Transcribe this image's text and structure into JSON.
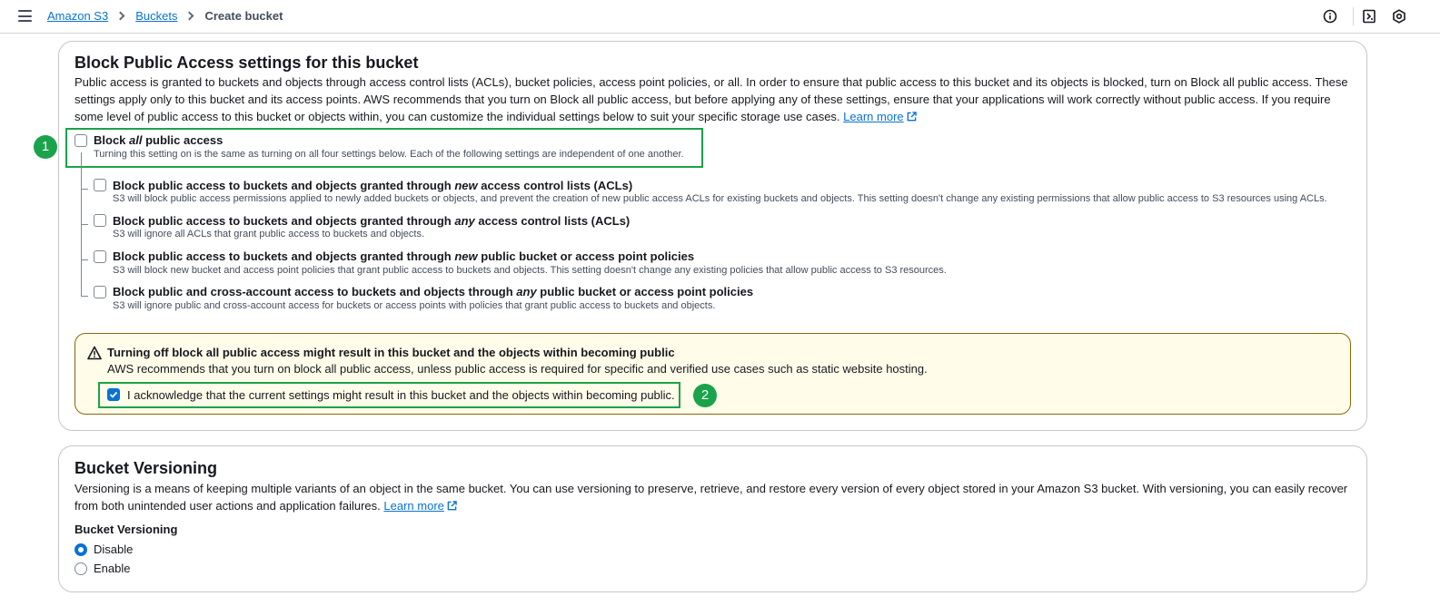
{
  "breadcrumb": {
    "items": [
      "Amazon S3",
      "Buckets"
    ],
    "current": "Create bucket"
  },
  "icons": [
    "menu-icon",
    "info-icon",
    "feedback-icon",
    "settings-icon"
  ],
  "block_public_access": {
    "title": "Block Public Access settings for this bucket",
    "description": "Public access is granted to buckets and objects through access control lists (ACLs), bucket policies, access point policies, or all. In order to ensure that public access to this bucket and its objects is blocked, turn on Block all public access. These settings apply only to this bucket and its access points. AWS recommends that you turn on Block all public access, but before applying any of these settings, ensure that your applications will work correctly without public access. If you require some level of public access to this bucket or objects within, you can customize the individual settings below to suit your specific storage use cases.",
    "learn_more": "Learn more",
    "block_all": {
      "pre": "Block ",
      "em": "all",
      "post": " public access",
      "description": "Turning this setting on is the same as turning on all four settings below. Each of the following settings are independent of one another.",
      "checked": false
    },
    "options": [
      {
        "pre": "Block public access to buckets and objects granted through ",
        "em": "new",
        "post": " access control lists (ACLs)",
        "description": "S3 will block public access permissions applied to newly added buckets or objects, and prevent the creation of new public access ACLs for existing buckets and objects. This setting doesn't change any existing permissions that allow public access to S3 resources using ACLs.",
        "checked": false
      },
      {
        "pre": "Block public access to buckets and objects granted through ",
        "em": "any",
        "post": " access control lists (ACLs)",
        "description": "S3 will ignore all ACLs that grant public access to buckets and objects.",
        "checked": false
      },
      {
        "pre": "Block public access to buckets and objects granted through ",
        "em": "new",
        "post": " public bucket or access point policies",
        "description": "S3 will block new bucket and access point policies that grant public access to buckets and objects. This setting doesn't change any existing policies that allow public access to S3 resources.",
        "checked": false
      },
      {
        "pre": "Block public and cross-account access to buckets and objects through ",
        "em": "any",
        "post": " public bucket or access point policies",
        "description": "S3 will ignore public and cross-account access for buckets or access points with policies that grant public access to buckets and objects.",
        "checked": false
      }
    ],
    "warning": {
      "title": "Turning off block all public access might result in this bucket and the objects within becoming public",
      "description": "AWS recommends that you turn on block all public access, unless public access is required for specific and verified use cases such as static website hosting.",
      "acknowledge": "I acknowledge that the current settings might result in this bucket and the objects within becoming public.",
      "acknowledged": true
    },
    "markers": [
      "1",
      "2"
    ]
  },
  "versioning": {
    "title": "Bucket Versioning",
    "description": "Versioning is a means of keeping multiple variants of an object in the same bucket. You can use versioning to preserve, retrieve, and restore every version of every object stored in your Amazon S3 bucket. With versioning, you can easily recover from both unintended user actions and application failures.",
    "learn_more": "Learn more",
    "label": "Bucket Versioning",
    "options": [
      "Disable",
      "Enable"
    ],
    "selected": "Disable"
  },
  "colors": {
    "link": "#0972d3",
    "highlight": "#1aa34a",
    "warning_bg": "#fffce9",
    "warning_border": "#8d6605"
  }
}
